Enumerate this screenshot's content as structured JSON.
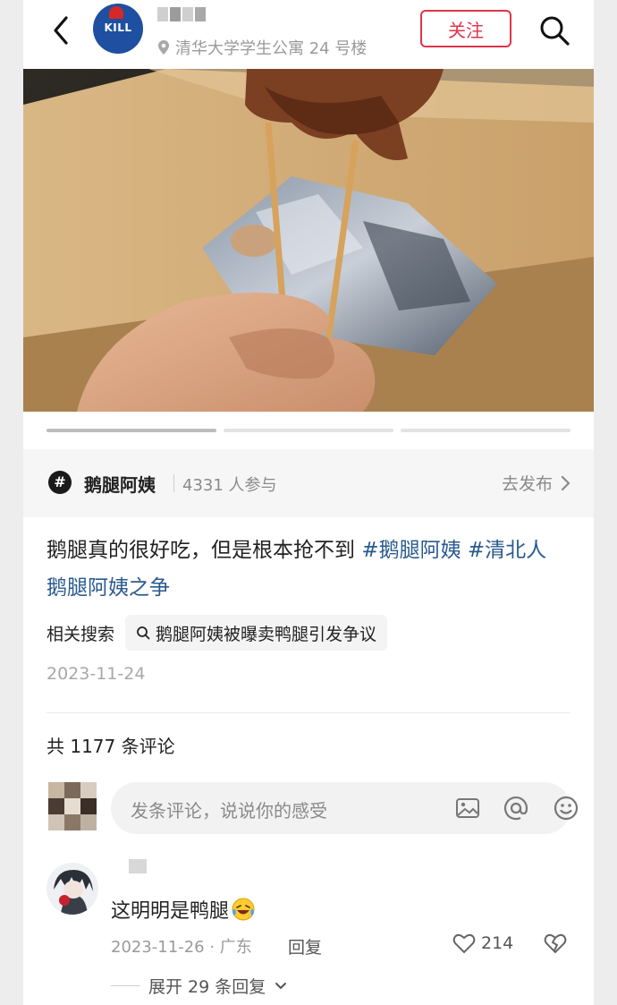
{
  "header": {
    "location": "清华大学学生公寓 24 号楼",
    "follow_label": "关注",
    "avatar_text": "KILL"
  },
  "video": {
    "progress": {
      "segments": 3,
      "active": 1
    }
  },
  "topic": {
    "name": "鹅腿阿姨",
    "participants": "4331 人参与",
    "action": "去发布"
  },
  "post": {
    "caption_plain": "鹅腿真的很好吃，但是根本抢不到 ",
    "tag1": "#鹅腿阿姨",
    "tag2": " #清北人鹅腿阿姨之争",
    "related_label": "相关搜索",
    "related_query": "鹅腿阿姨被曝卖鸭腿引发争议",
    "date": "2023-11-24"
  },
  "comments": {
    "count_label": "共 1177 条评论",
    "input_placeholder": "发条评论，说说你的感受",
    "items": [
      {
        "text": "这明明是鸭腿",
        "meta": "2023-11-26 · 广东",
        "reply_label": "回复",
        "likes": "214",
        "expand_label": "展开 29 条回复"
      }
    ]
  },
  "colors": {
    "accent": "#e0344c",
    "hashtag": "#2a5a8f"
  }
}
